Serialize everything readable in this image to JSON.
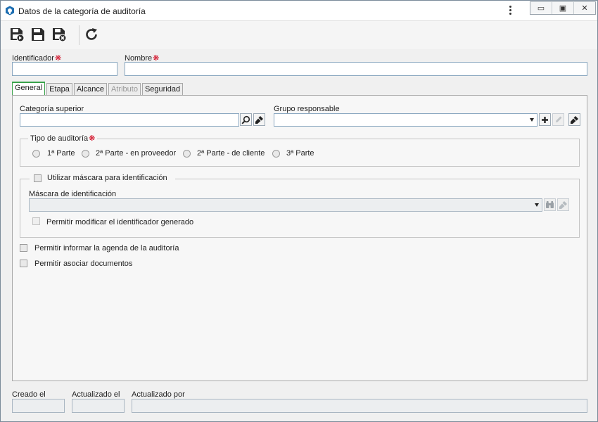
{
  "window": {
    "title": "Datos de la categoría de auditoría",
    "min_glyph": "▭",
    "max_glyph": "▣",
    "close_glyph": "✕"
  },
  "toolbar": {
    "buttons": [
      {
        "name": "save-and-new",
        "icon": "save-new-icon"
      },
      {
        "name": "save",
        "icon": "floppy-disk-icon"
      },
      {
        "name": "save-and-close",
        "icon": "save-close-icon"
      },
      {
        "name": "refresh",
        "icon": "refresh-icon"
      }
    ]
  },
  "form": {
    "identifier_label": "Identificador",
    "identifier_value": "",
    "name_label": "Nombre",
    "name_value": "",
    "required_marker": "❋"
  },
  "tabs": [
    {
      "label": "General",
      "state": "active"
    },
    {
      "label": "Etapa",
      "state": "normal"
    },
    {
      "label": "Alcance",
      "state": "normal"
    },
    {
      "label": "Atributo",
      "state": "disabled"
    },
    {
      "label": "Seguridad",
      "state": "normal"
    }
  ],
  "general": {
    "parent_category_label": "Categoría superior",
    "parent_category_value": "",
    "responsible_group_label": "Grupo responsable",
    "responsible_group_value": "",
    "audit_type_legend": "Tipo de auditoría",
    "audit_types": [
      "1ª Parte",
      "2ª Parte - en proveedor",
      "2ª Parte - de cliente",
      "3ª Parte"
    ],
    "use_mask_label": "Utilizar máscara para identificación",
    "mask_label": "Máscara de identificación",
    "mask_value": "",
    "allow_modify_label": "Permitir modificar el identificador generado",
    "allow_agenda_label": "Permitir informar la agenda de la auditoría",
    "allow_documents_label": "Permitir asociar documentos"
  },
  "footer": {
    "created_label": "Creado el",
    "created_value": "",
    "updated_label": "Actualizado el",
    "updated_value": "",
    "updated_by_label": "Actualizado por",
    "updated_by_value": ""
  },
  "colors": {
    "accent_green": "#39a24a",
    "required_red": "#d0021b",
    "field_border": "#8aa7c0"
  }
}
